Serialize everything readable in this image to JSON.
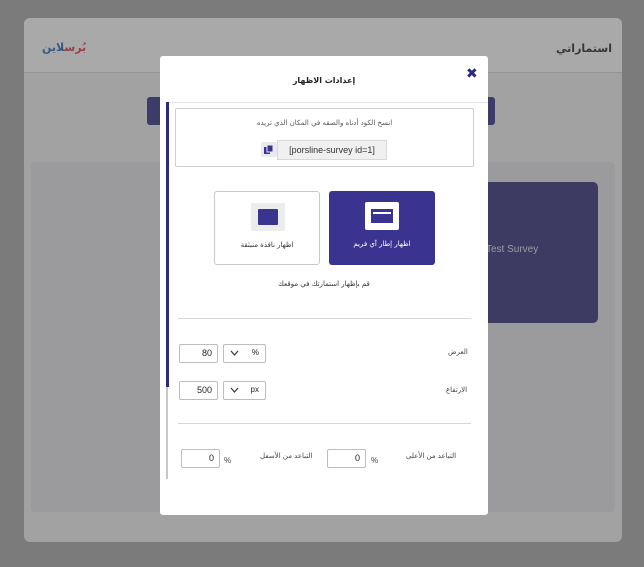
{
  "background": {
    "page_title": "استماراتي",
    "logo_part1": "بُرس",
    "logo_part2": "لاين",
    "survey_card_title": "Test Survey"
  },
  "modal": {
    "title": "إعدادات الاظهار",
    "close_icon": "close-icon",
    "code_hint": "انسخ الكود أدناه والصقه في المكان الذي تريده",
    "shortcode": "[porsline-survey id=1]",
    "copy_icon": "copy-icon",
    "options": {
      "popup_label": "اظهار نافذة منبثقة",
      "frame_label": "اظهار إطار آي فريم",
      "selected": "frame"
    },
    "show_note": "قم بإظهار استمارتك في موقعك",
    "width": {
      "label": "العرض",
      "value": "80",
      "unit": "%"
    },
    "height": {
      "label": "الارتفاع",
      "value": "500",
      "unit": "px"
    },
    "margin_top": {
      "label": "التباعد من الأعلى",
      "value": "0",
      "unit": "%"
    },
    "margin_bottom": {
      "label": "التباعد من الأسفل",
      "value": "0",
      "unit": "%"
    },
    "colors": {
      "accent": "#3a3490",
      "close": "#2d2a7a"
    }
  }
}
